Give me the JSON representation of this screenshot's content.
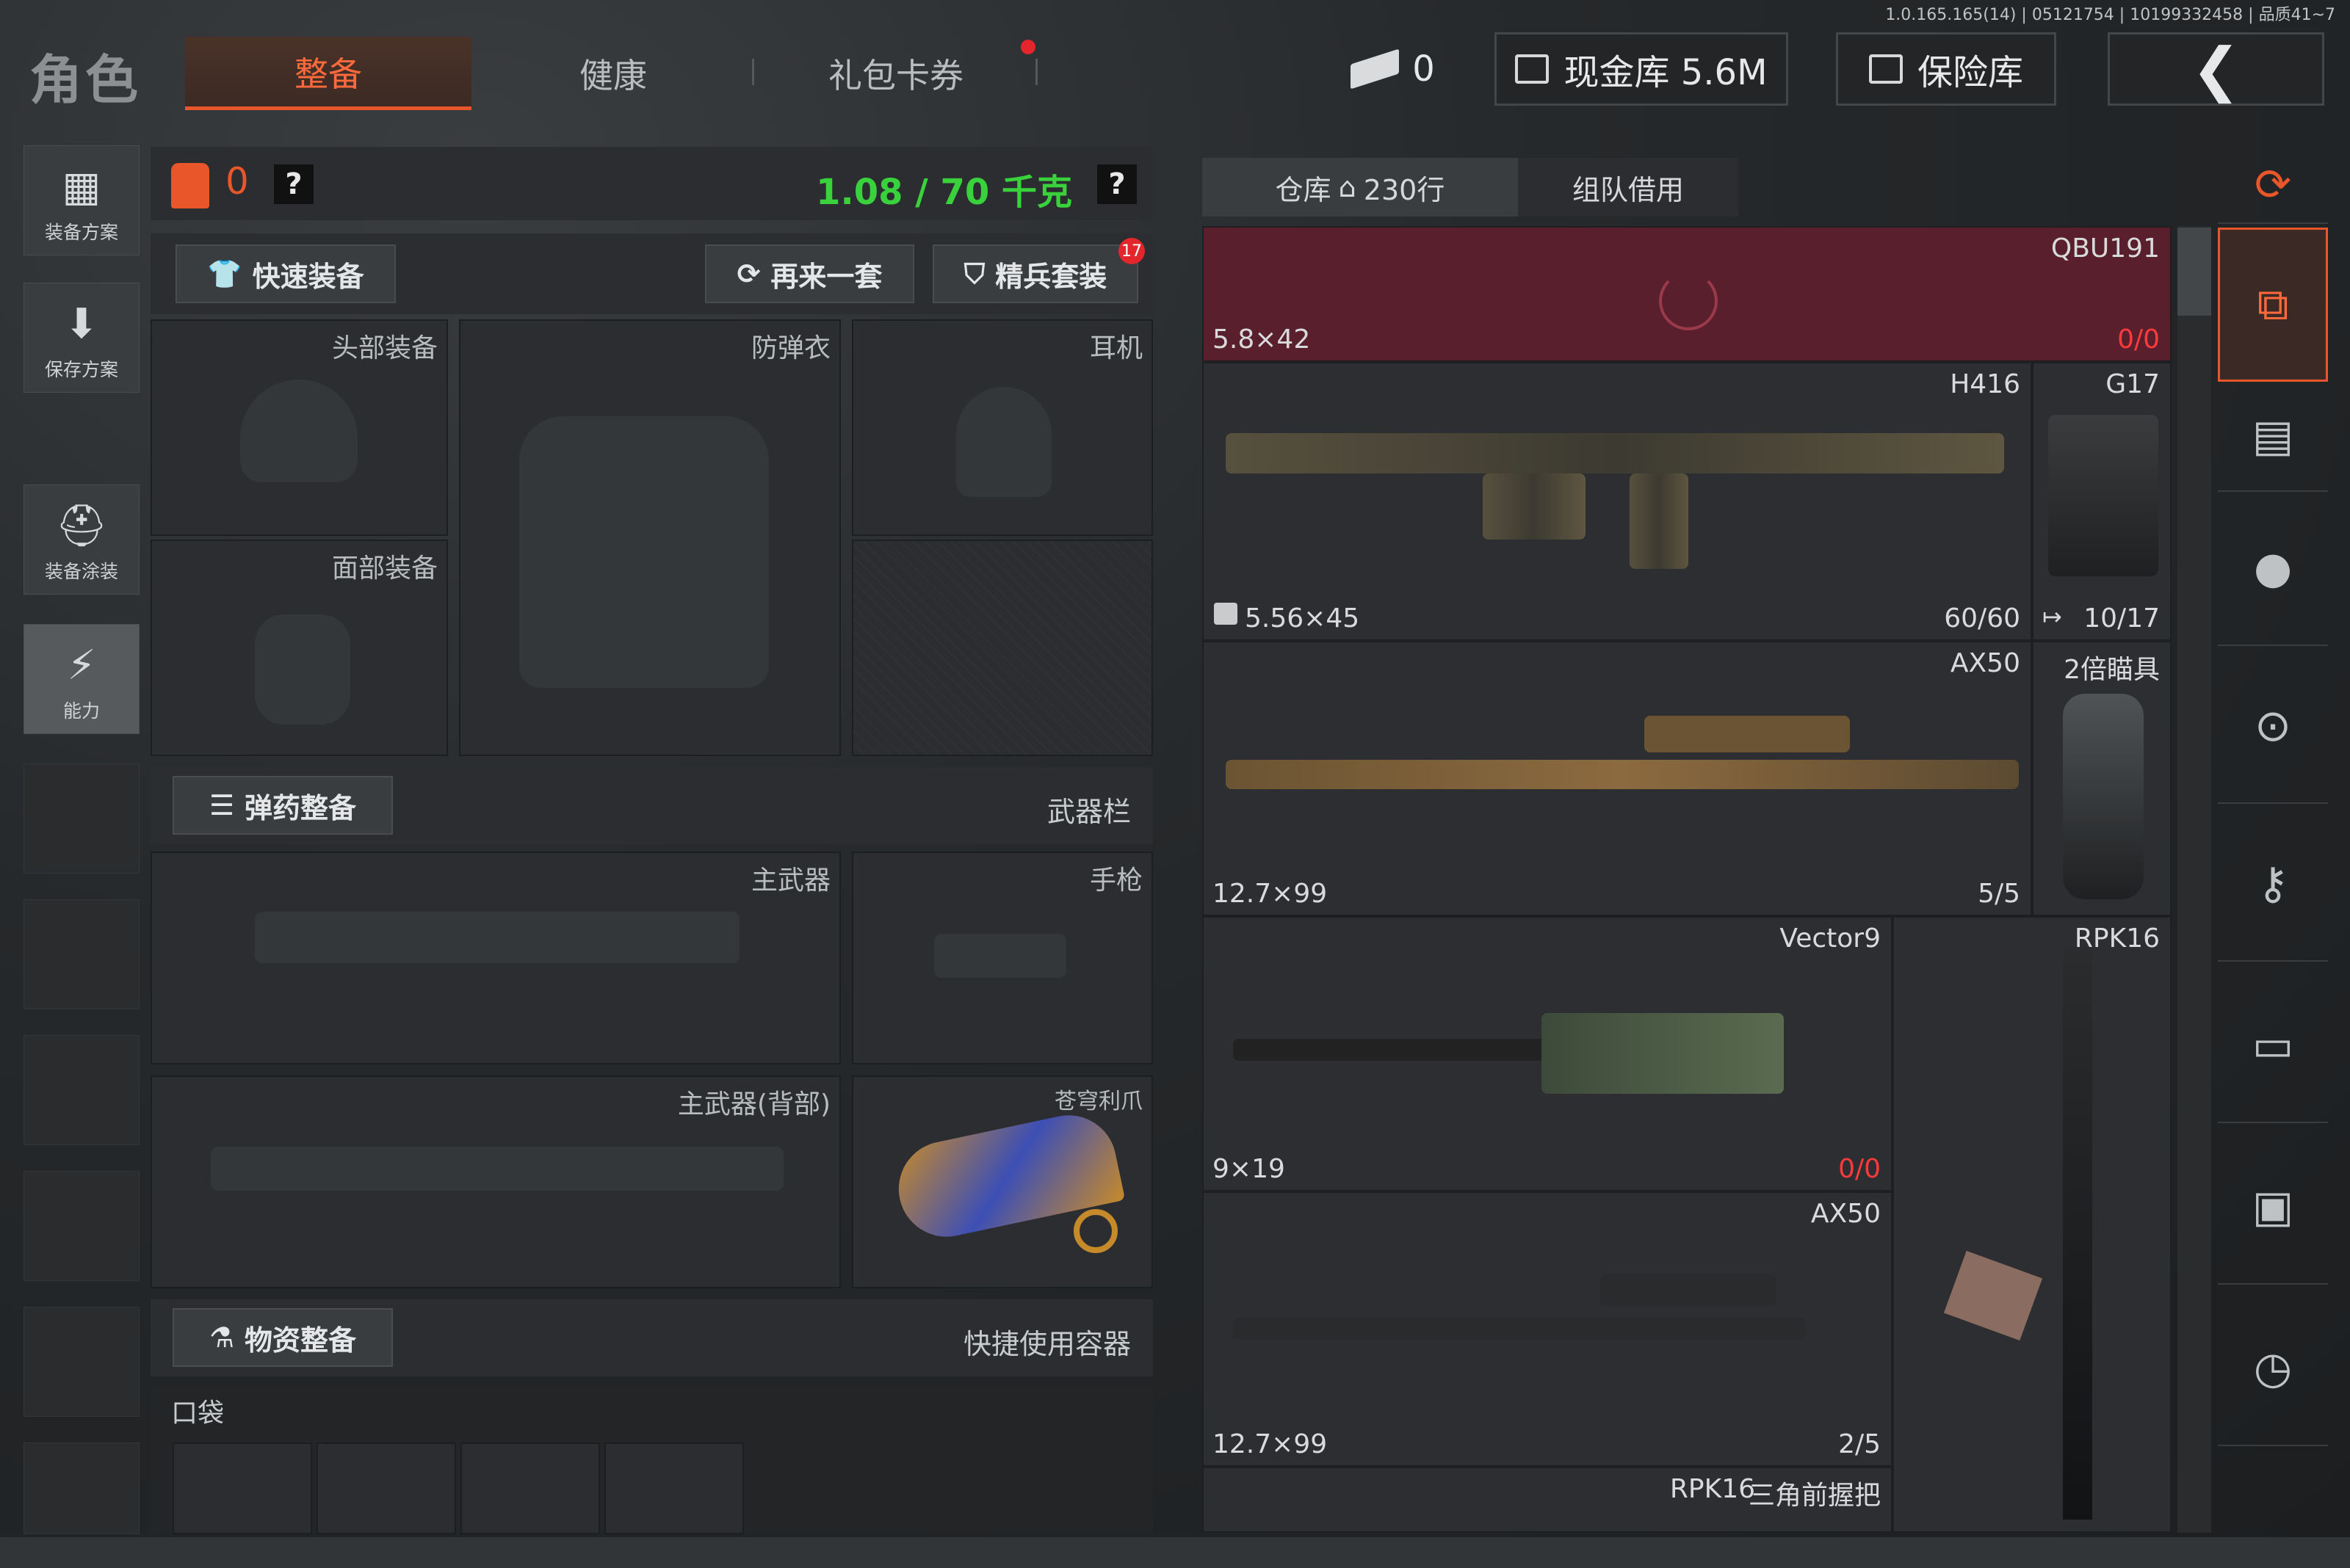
{
  "build_info": "1.0.165.165(14) | 05121754 | 10199332458 | 品质41~7",
  "header": {
    "title": "角色",
    "tabs": [
      {
        "label": "整备",
        "active": true
      },
      {
        "label": "健康",
        "active": false
      },
      {
        "label": "礼包卡券",
        "active": false
      }
    ],
    "tickets": "0",
    "cash_vault": "现金库 5.6M",
    "safe": "保险库"
  },
  "sidebar": {
    "items": [
      {
        "label": "装备方案",
        "icon": "vest-icon"
      },
      {
        "label": "保存方案",
        "icon": "download-icon"
      },
      {
        "label": "装备涂装",
        "icon": "helmet-paint-icon"
      },
      {
        "label": "能力",
        "icon": "ability-icon"
      }
    ]
  },
  "loadout": {
    "backpack_count": "0",
    "weight": "1.08 / 70 千克",
    "quick_equip": "快速装备",
    "again": "再来一套",
    "elite_set": "精兵套装",
    "elite_badge": "17",
    "slots": {
      "head": "头部装备",
      "armor": "防弹衣",
      "headset": "耳机",
      "face": "面部装备"
    },
    "ammo_section": "弹药整备",
    "weapon_bar": "武器栏",
    "weapons": {
      "primary": "主武器",
      "pistol": "手枪",
      "primary_back": "主武器(背部)",
      "melee": "苍穹利爪"
    },
    "supply_section": "物资整备",
    "quick_container": "快捷使用容器",
    "pocket": "口袋"
  },
  "storage": {
    "tabs": [
      {
        "label": "仓库",
        "rows": "230行",
        "active": true
      },
      {
        "label": "组队借用",
        "active": false
      }
    ],
    "items": [
      {
        "name": "QBU191",
        "caliber": "5.8×42",
        "ammo": "0/0",
        "ammo_red": true
      },
      {
        "name": "H416",
        "caliber": "5.56×45",
        "ammo": "60/60"
      },
      {
        "name": "G17",
        "ammo": "10/17"
      },
      {
        "name": "AX50",
        "caliber": "12.7×99",
        "ammo": "5/5"
      },
      {
        "name": "2倍瞄具"
      },
      {
        "name": "Vector9",
        "caliber": "9×19",
        "ammo": "0/0",
        "ammo_red": true
      },
      {
        "name": "RPK16"
      },
      {
        "name": "AX50",
        "caliber": "12.7×99",
        "ammo": "2/5"
      },
      {
        "name": "RPK16"
      },
      {
        "name": "三角前握把"
      }
    ]
  },
  "colors": {
    "accent": "#e8562a",
    "weight_green": "#39d13c",
    "ammo_red": "#ff3a3a",
    "highlight_row": "#5a1f2c"
  }
}
